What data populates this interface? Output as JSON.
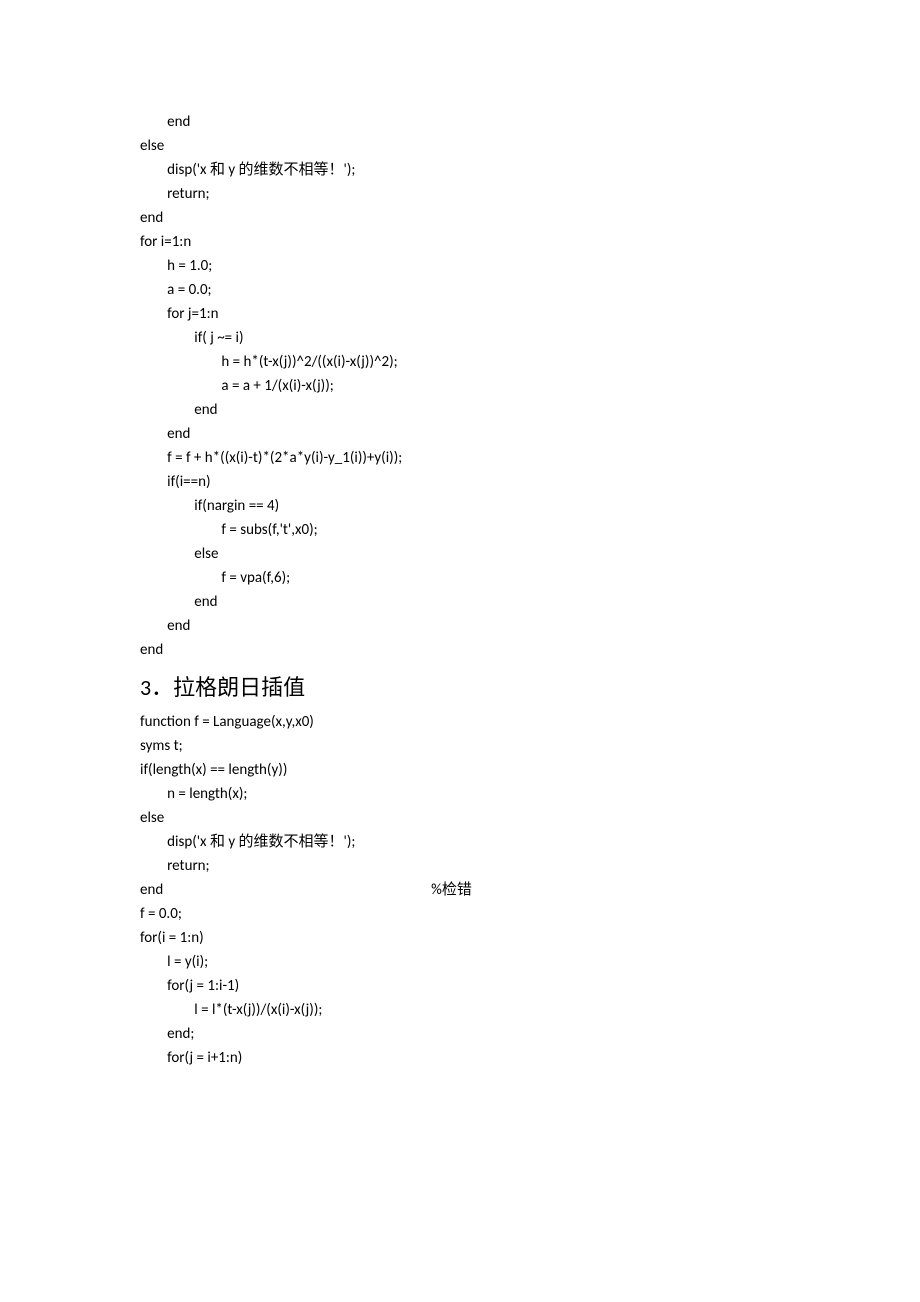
{
  "block1": {
    "l1": "        end",
    "l2": "else",
    "l3": "        disp('x 和 y 的维数不相等！');",
    "l4": "        return;",
    "l5": "end",
    "l6": "",
    "l7": "for i=1:n",
    "l8": "        h = 1.0;",
    "l9": "        a = 0.0;",
    "l10": "        for j=1:n",
    "l11": "                if( j ~= i)",
    "l12": "                        h = h*(t-x(j))^2/((x(i)-x(j))^2);",
    "l13": "                        a = a + 1/(x(i)-x(j));",
    "l14": "                end",
    "l15": "        end",
    "l16": "",
    "l17": "        f = f + h*((x(i)-t)*(2*a*y(i)-y_1(i))+y(i));",
    "l18": "",
    "l19": "        if(i==n)",
    "l20": "                if(nargin == 4)",
    "l21": "                        f = subs(f,'t',x0);",
    "l22": "                else",
    "l23": "                        f = vpa(f,6);",
    "l24": "                end",
    "l25": "        end",
    "l26": "end"
  },
  "heading": {
    "num": "3．",
    "text": "拉格朗日插值"
  },
  "block2": {
    "l1": "function f = Language(x,y,x0)",
    "l2": "syms t;",
    "l3": "if(length(x) == length(y))",
    "l4": "        n = length(x);",
    "l5": "else",
    "l6": "        disp('x 和 y 的维数不相等！');",
    "l7": "        return;",
    "l8": "end                                                                               %检错",
    "l9": "",
    "l10": "f = 0.0;",
    "l11": "for(i = 1:n)",
    "l12": "        l = y(i);",
    "l13": "        for(j = 1:i-1)",
    "l14": "                l = l*(t-x(j))/(x(i)-x(j));",
    "l15": "        end;",
    "l16": "        for(j = i+1:n)"
  }
}
